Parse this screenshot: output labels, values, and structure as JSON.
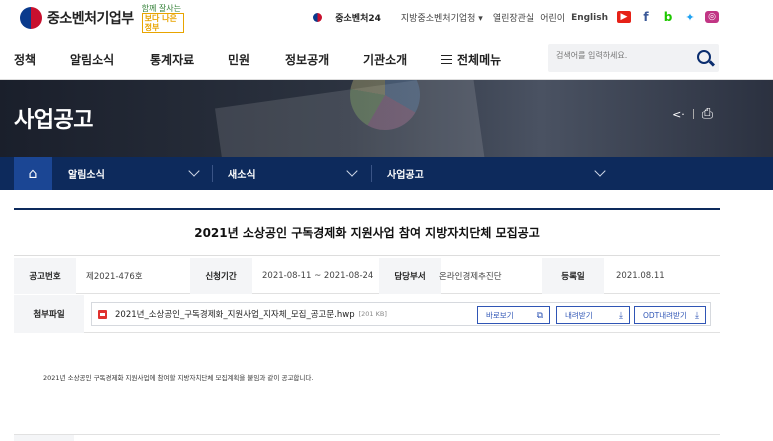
{
  "header": {
    "brand": "중소벤처기업부",
    "slogan_small": "함께 잘사는",
    "slogan_main": "보다 나은 정부",
    "site24": "중소벤처24",
    "regional": "지방중소벤처기업청",
    "links": [
      "열린장관실",
      "어린이",
      "English"
    ],
    "social_icons": [
      "youtube-icon",
      "facebook-icon",
      "blog-icon",
      "twitter-icon",
      "instagram-icon"
    ],
    "colors": {
      "youtube": "#e62117",
      "facebook": "#3b5998",
      "blog": "#1ec800",
      "twitter": "#1da1f2",
      "instagram": "#c13584"
    }
  },
  "gnb": {
    "items": [
      "정책",
      "알림소식",
      "통계자료",
      "민원",
      "정보공개",
      "기관소개"
    ],
    "all_menu": "전체메뉴",
    "search_placeholder": "검색어를 입력하세요."
  },
  "hero": {
    "title": "사업공고",
    "share_glyph": "⟨",
    "print_glyph": "⎙"
  },
  "location": {
    "home_glyph": "⌂",
    "level1": "알림소식",
    "level2": "새소식",
    "level3": "사업공고"
  },
  "article": {
    "title": "2021년 소상공인 구독경제화 지원사업 참여 지방자치단체 모집공고",
    "meta": {
      "number_label": "공고번호",
      "number": "제2021-476호",
      "period_label": "신청기간",
      "period": "2021-08-11 ~ 2021-08-24",
      "dept_label": "담당부서",
      "dept": "온라인경제추진단",
      "date_label": "등록일",
      "date": "2021.08.11"
    },
    "attachment": {
      "label": "첨부파일",
      "file_name": "2021년_소상공인_구독경제화_지원사업_지자체_모집_공고문.hwp",
      "file_size": "[201 KB]",
      "view_label": "바로보기",
      "download_label": "내려받기",
      "odt_label": "ODT내려받기"
    },
    "body": "2021년 소상공인 구독경제화 지원사업에 참여할 지방자치단체 모집계획을 붙임과 같이 공고합니다."
  }
}
